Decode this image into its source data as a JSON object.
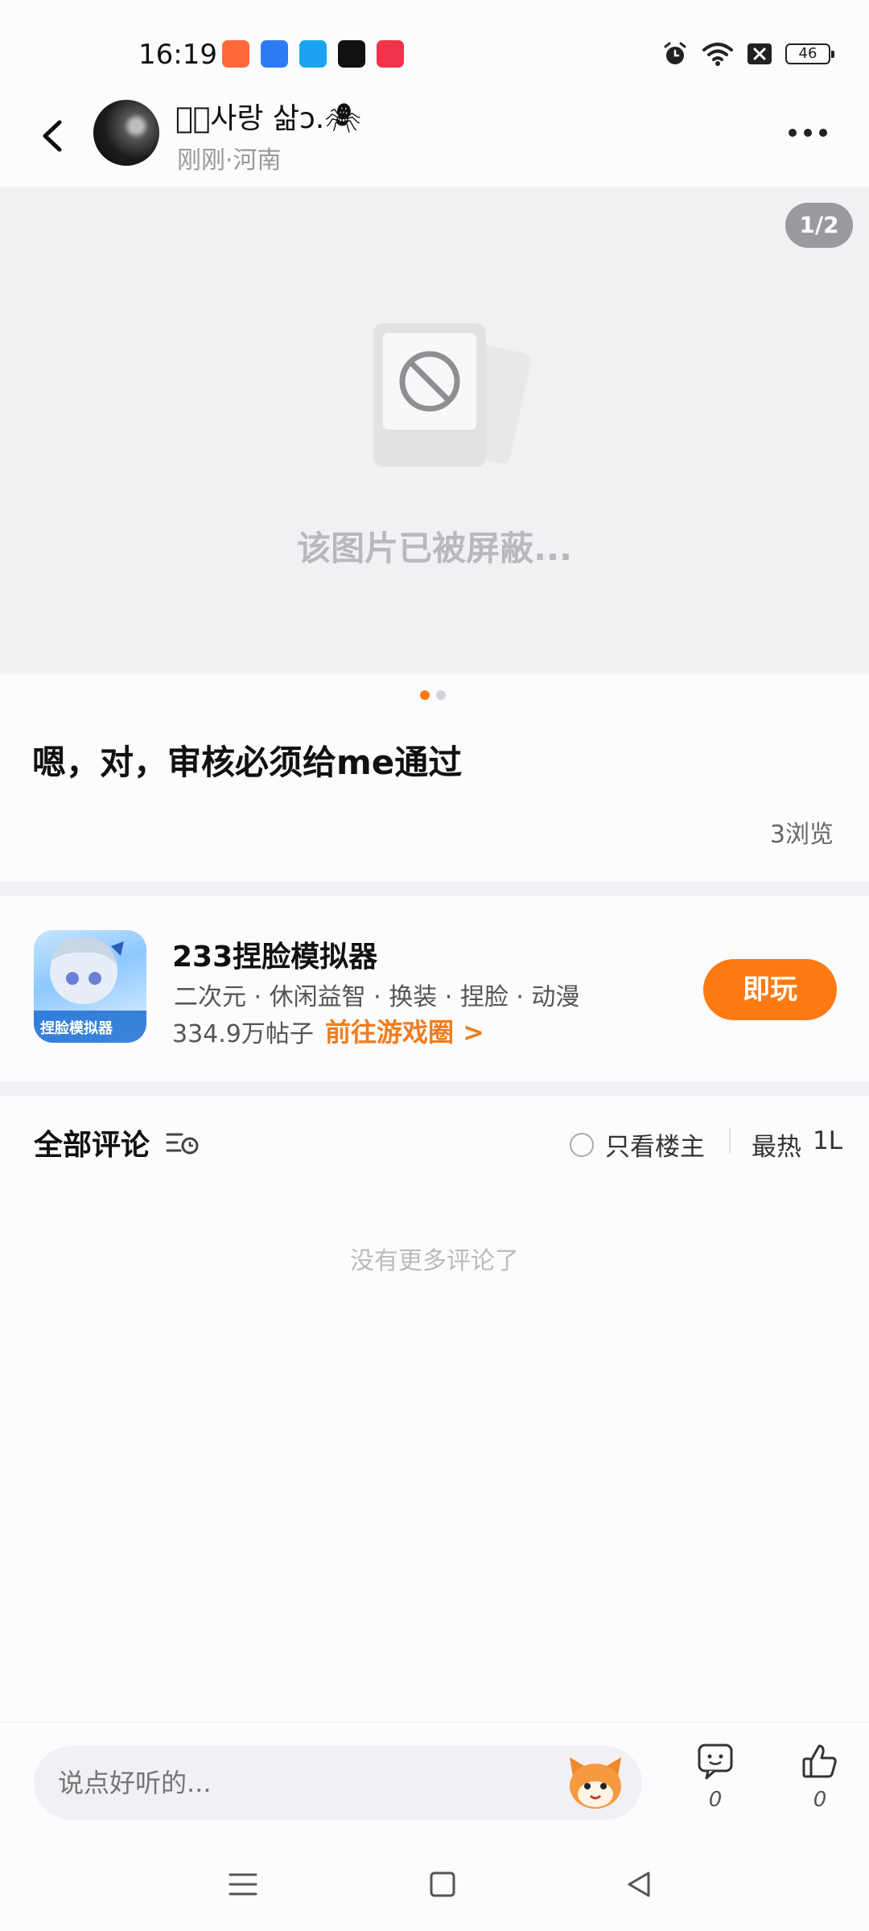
{
  "status_bar": {
    "time": "16:19",
    "app_icons": [
      {
        "name": "app-icon-1",
        "color": "#ff6a3a"
      },
      {
        "name": "app-icon-2",
        "color": "#2d7cf6"
      },
      {
        "name": "app-icon-3",
        "color": "#1aa3f0"
      },
      {
        "name": "app-icon-4",
        "color": "#111111"
      },
      {
        "name": "app-icon-5",
        "color": "#f0334a"
      }
    ],
    "battery": "46"
  },
  "header": {
    "username": "𝓜ꦿ사랑 삶ɔ.🕷",
    "meta": "刚刚·河南"
  },
  "post": {
    "page_counter": "1/2",
    "blocked_text": "该图片已被屏蔽...",
    "text": "嗯，对，审核必须给me通过",
    "views": "3浏览"
  },
  "game_card": {
    "title": "233捏脸模拟器",
    "tags": "二次元 · 休闲益智 · 换装 · 捏脸 · 动漫",
    "posts": "334.9万帖子",
    "link": "前往游戏圈 >",
    "play_label": "即玩",
    "icon_caption": "捏脸模拟器"
  },
  "comments": {
    "title": "全部评论",
    "op_only": "只看楼主",
    "sort": "最热",
    "sort_icon_text": "1L",
    "empty": "没有更多评论了"
  },
  "bottom_bar": {
    "placeholder": "说点好听的...",
    "comment_count": "0",
    "like_count": "0"
  },
  "colors": {
    "accent": "#ff7a12",
    "background": "#fcfbfd"
  }
}
